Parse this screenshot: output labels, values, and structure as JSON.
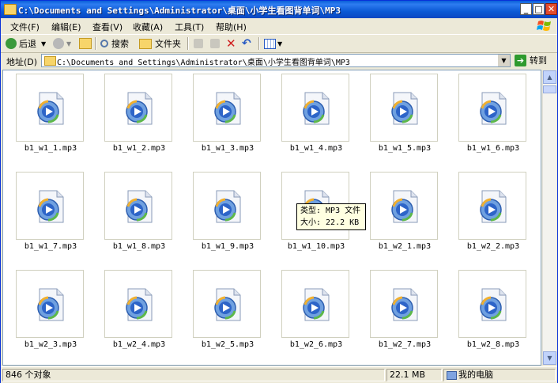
{
  "window": {
    "title": "C:\\Documents and Settings\\Administrator\\桌面\\小学生看图背单词\\MP3",
    "buttons": {
      "minimize": "_",
      "maximize": "□",
      "close": "✕"
    }
  },
  "menu": [
    "文件(F)",
    "编辑(E)",
    "查看(V)",
    "收藏(A)",
    "工具(T)",
    "帮助(H)"
  ],
  "toolbar": {
    "back": "后退",
    "search": "搜索",
    "folders": "文件夹"
  },
  "address": {
    "label": "地址(D)",
    "value": "C:\\Documents and Settings\\Administrator\\桌面\\小学生看图背单词\\MP3",
    "go": "转到"
  },
  "files": [
    "b1_w1_1.mp3",
    "b1_w1_2.mp3",
    "b1_w1_3.mp3",
    "b1_w1_4.mp3",
    "b1_w1_5.mp3",
    "b1_w1_6.mp3",
    "b1_w1_7.mp3",
    "b1_w1_8.mp3",
    "b1_w1_9.mp3",
    "b1_w1_10.mp3",
    "b1_w2_1.mp3",
    "b1_w2_2.mp3",
    "b1_w2_3.mp3",
    "b1_w2_4.mp3",
    "b1_w2_5.mp3",
    "b1_w2_6.mp3",
    "b1_w2_7.mp3",
    "b1_w2_8.mp3"
  ],
  "tooltip": {
    "type": "类型: MP3 文件",
    "size": "大小: 22.2 KB"
  },
  "status": {
    "count": "846 个对象",
    "size": "22.1 MB",
    "location": "我的电脑"
  },
  "icons": {
    "file": "media-player-icon",
    "folder": "folder-icon"
  },
  "colors": {
    "titlebar": "#0A5FD8",
    "selection_tooltip": "#FFFFE1"
  }
}
